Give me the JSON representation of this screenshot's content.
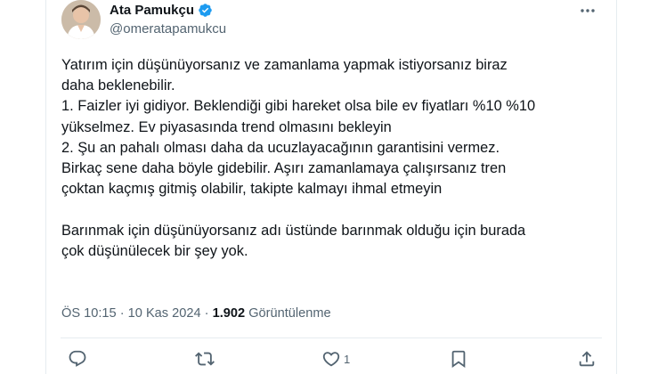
{
  "author": {
    "display_name": "Ata Pamukçu",
    "handle": "@omeratapamukcu",
    "verified_color": "#1d9bf0"
  },
  "tweet": {
    "lines": [
      "Yatırım için düşünüyorsanız ve zamanlama yapmak istiyorsanız biraz",
      "daha beklenebilir.",
      "1. Faizler iyi gidiyor. Beklendiği gibi hareket olsa bile ev fiyatları %10 %10",
      "yükselmez. Ev piyasasında trend olmasını bekleyin",
      "2. Şu an pahalı olması daha da ucuzlayacağının garantisini vermez.",
      "Birkaç sene daha böyle gidebilir. Aşırı zamanlamaya çalışırsanız tren",
      "çoktan kaçmış gitmiş olabilir, takipte kalmayı ihmal etmeyin",
      "",
      "Barınmak için düşünüyorsanız adı üstünde barınmak olduğu için burada",
      "çok düşünülecek bir şey yok."
    ]
  },
  "meta": {
    "time": "ÖS 10:15",
    "separator": " · ",
    "date": "10 Kas 2024",
    "separator2": " · ",
    "views_count": "1.902",
    "views_label": " Görüntülenme"
  },
  "actions": {
    "reply_icon": "reply-icon",
    "retweet_icon": "retweet-icon",
    "like_icon": "heart-icon",
    "like_count": "1",
    "bookmark_icon": "bookmark-icon",
    "share_icon": "share-icon"
  },
  "colors": {
    "text": "#0f1419",
    "secondary": "#536471",
    "border": "#e6ecf0",
    "accent": "#1d9bf0"
  }
}
